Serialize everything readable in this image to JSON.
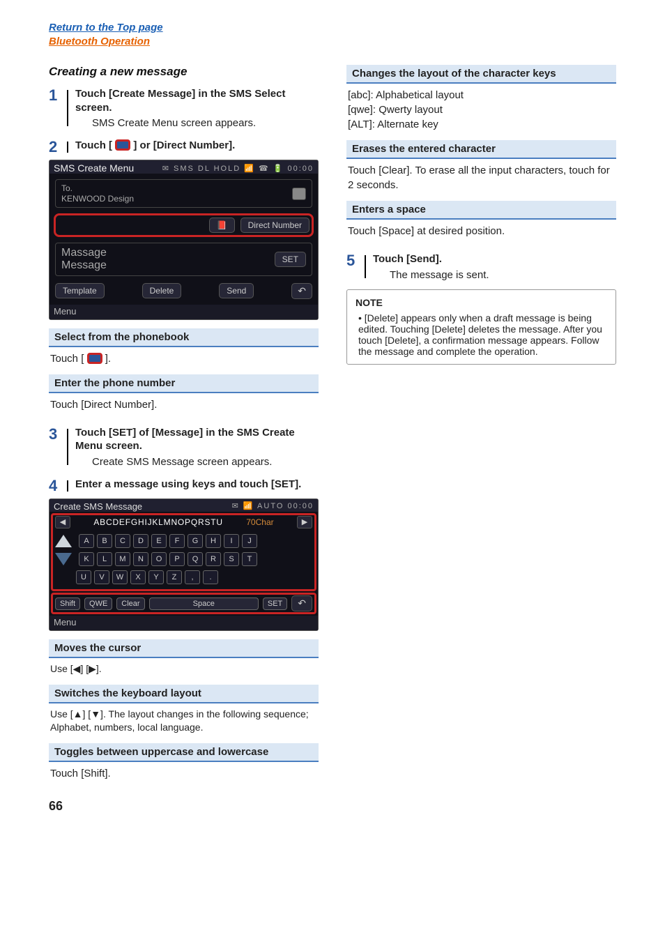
{
  "top": {
    "link1": "Return to the Top page",
    "link2": "Bluetooth Operation"
  },
  "heading": "Creating a new message",
  "left": {
    "step1": {
      "num": "1",
      "cmd": "Touch [Create Message] in the SMS Select screen.",
      "explain": "SMS Create Menu screen appears."
    },
    "step2": {
      "num": "2",
      "cmd_a": "Touch [ ",
      "cmd_b": " ] or [Direct Number]."
    },
    "sms_menu": {
      "title": "SMS Create Menu",
      "clock": "00:00",
      "to": "To.",
      "to_name": "KENWOOD Design",
      "direct_number": "Direct Number",
      "massage": "Massage",
      "message": "Message",
      "set": "SET",
      "template": "Template",
      "delete": "Delete",
      "send": "Send",
      "menu": "Menu"
    },
    "bar1": "Select from the phonebook",
    "desc1a": "Touch [ ",
    "desc1b": " ].",
    "bar2": "Enter the phone number",
    "desc2": "Touch [Direct Number].",
    "step3": {
      "num": "3",
      "cmd": "Touch [SET] of [Message] in the SMS Create Menu screen.",
      "explain": "Create SMS Message screen appears."
    },
    "step4": {
      "num": "4",
      "cmd": "Enter a message using keys and touch [SET]."
    },
    "kb": {
      "title": "Create SMS Message",
      "chars": "ABCDEFGHIJKLMNOPQRSTU",
      "count": "70Char",
      "row1": [
        "A",
        "B",
        "C",
        "D",
        "E",
        "F",
        "G",
        "H",
        "I",
        "J"
      ],
      "row2": [
        "K",
        "L",
        "M",
        "N",
        "O",
        "P",
        "Q",
        "R",
        "S",
        "T"
      ],
      "row3": [
        "U",
        "V",
        "W",
        "X",
        "Y",
        "Z",
        ",",
        "."
      ],
      "shift": "Shift",
      "qwe": "QWE",
      "clear": "Clear",
      "space": "Space",
      "set": "SET",
      "menu": "Menu"
    },
    "bar3": "Moves the cursor",
    "desc3": "Use [◀] [▶].",
    "bar4": "Switches the keyboard layout",
    "desc4": "Use [▲] [▼]. The layout changes in the following sequence; Alphabet, numbers, local language.",
    "bar5": "Toggles between uppercase and lowercase",
    "desc5": "Touch [Shift]."
  },
  "right": {
    "bar6": "Changes the layout of the character keys",
    "layout_abc_k": "[abc]",
    "layout_abc_v": ": Alphabetical layout",
    "layout_qwe_k": "[qwe]",
    "layout_qwe_v": ": Qwerty layout",
    "layout_alt_k": "[ALT]",
    "layout_alt_v": ": Alternate key",
    "bar7": "Erases the entered character",
    "desc7": "Touch [Clear]. To erase all the input characters, touch for 2 seconds.",
    "bar8": "Enters a space",
    "desc8": "Touch [Space] at desired position.",
    "step5": {
      "num": "5",
      "cmd": "Touch [Send].",
      "explain": "The message is sent."
    },
    "note_h": "NOTE",
    "note_b": "[Delete] appears only when a draft message is being edited. Touching [Delete] deletes the message. After you touch [Delete], a confirmation message appears. Follow the message and complete the operation."
  },
  "page": "66"
}
